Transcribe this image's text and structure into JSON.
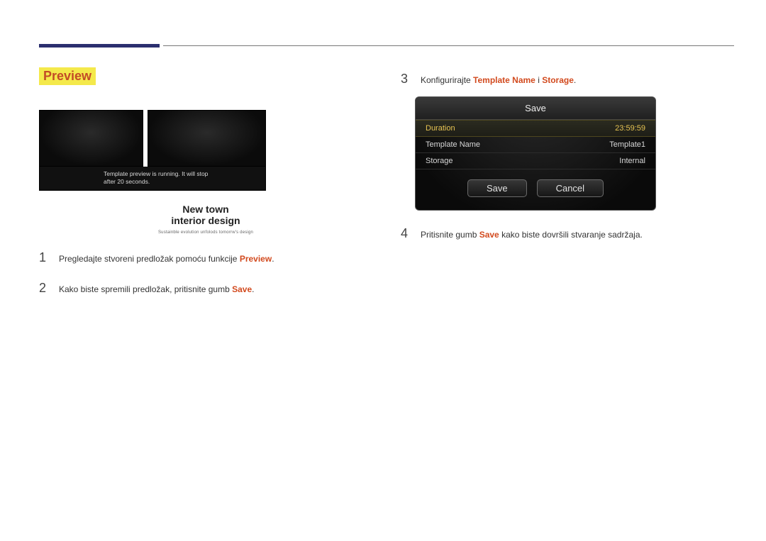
{
  "section_title": "Preview",
  "preview_overlay_l1": "Template preview is running. It will stop",
  "preview_overlay_l2": "after 20 seconds.",
  "caption_l1": "New  town",
  "caption_l2": "interior  design",
  "caption_sub": "Sustainble evolution unfolods tomorrw's design",
  "steps_left": [
    {
      "num": "1",
      "parts": [
        "Pregledajte stvoreni predložak pomoću funkcije ",
        "Preview",
        "."
      ]
    },
    {
      "num": "2",
      "parts": [
        "Kako biste spremili predložak, pritisnite gumb ",
        "Save",
        "."
      ]
    }
  ],
  "steps_right": [
    {
      "num": "3",
      "parts": [
        "Konfigurirajte ",
        "Template Name",
        " i ",
        "Storage",
        "."
      ]
    },
    {
      "num": "4",
      "parts": [
        "Pritisnite gumb ",
        "Save",
        " kako biste dovršili stvaranje sadržaja."
      ]
    }
  ],
  "dialog": {
    "title": "Save",
    "rows": [
      {
        "label": "Duration",
        "value": "23:59:59",
        "selected": true
      },
      {
        "label": "Template Name",
        "value": "Template1",
        "selected": false
      },
      {
        "label": "Storage",
        "value": "Internal",
        "selected": false
      }
    ],
    "btn_save": "Save",
    "btn_cancel": "Cancel"
  }
}
